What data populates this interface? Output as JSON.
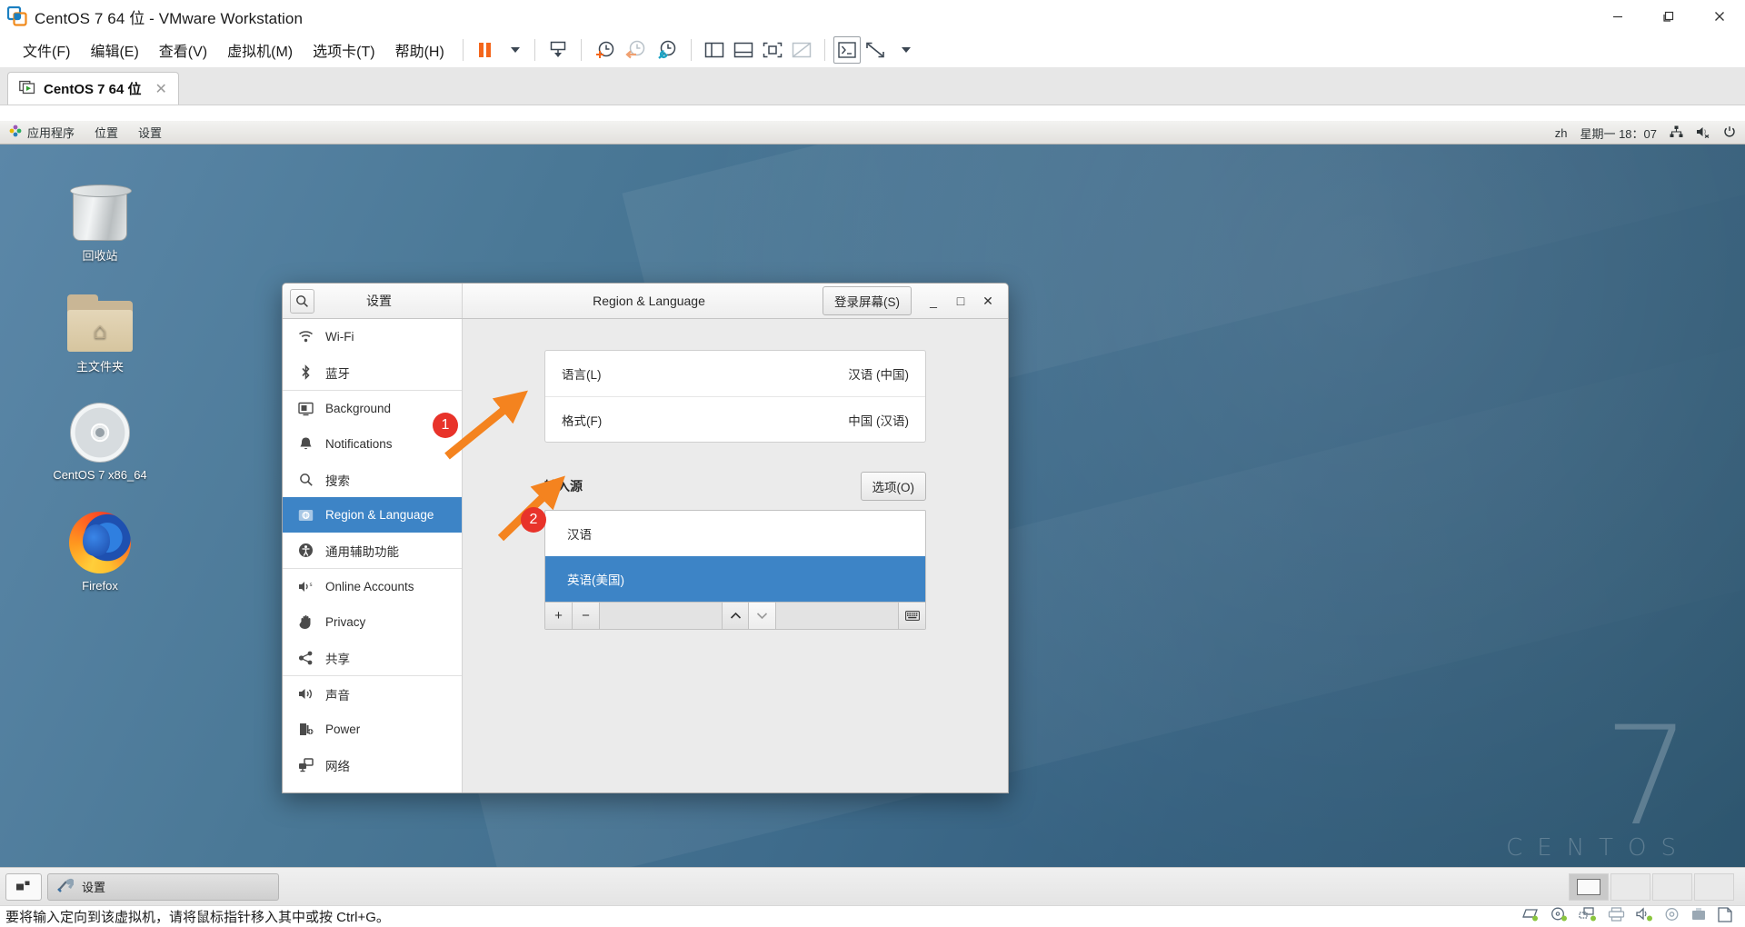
{
  "window": {
    "title": "CentOS 7 64 位 - VMware Workstation",
    "logo_icon": "vmware-logo-icon",
    "controls": {
      "minimize": "–",
      "maximize": "❐",
      "close": "✕"
    }
  },
  "menubar": {
    "items": [
      {
        "label": "文件(F)",
        "name": "menu-file"
      },
      {
        "label": "编辑(E)",
        "name": "menu-edit"
      },
      {
        "label": "查看(V)",
        "name": "menu-view"
      },
      {
        "label": "虚拟机(M)",
        "name": "menu-vm"
      },
      {
        "label": "选项卡(T)",
        "name": "menu-tabs"
      },
      {
        "label": "帮助(H)",
        "name": "menu-help"
      }
    ],
    "toolbar": [
      {
        "name": "suspend-button",
        "icon": "pause-icon"
      },
      {
        "name": "suspend-dropdown",
        "icon": "chevron-down-icon"
      },
      {
        "name": "power-options-button",
        "icon": "power-down-icon"
      },
      {
        "name": "take-snapshot-button",
        "icon": "snapshot-add-icon"
      },
      {
        "name": "revert-snapshot-button",
        "icon": "snapshot-revert-icon"
      },
      {
        "name": "manage-snapshots-button",
        "icon": "snapshot-manage-icon"
      },
      {
        "name": "show-library-button",
        "icon": "panel-left-icon"
      },
      {
        "name": "show-thumbnails-button",
        "icon": "panel-bottom-icon"
      },
      {
        "name": "show-console-button",
        "icon": "console-view-icon"
      },
      {
        "name": "unity-mode-button",
        "icon": "unity-icon"
      },
      {
        "name": "fullscreen-button",
        "icon": "fullscreen-icon"
      },
      {
        "name": "fullscreen-dropdown",
        "icon": "chevron-down-icon"
      }
    ]
  },
  "tabs": [
    {
      "label": "CentOS 7 64 位",
      "icon": "vm-running-icon",
      "close": "✕",
      "active": true
    }
  ],
  "gnome": {
    "topbar": {
      "left": [
        {
          "label": "应用程序",
          "name": "gnome-applications-menu",
          "icon": "centos-apps-icon"
        },
        {
          "label": "位置",
          "name": "gnome-places-menu"
        },
        {
          "label": "设置",
          "name": "gnome-settings-menu"
        }
      ],
      "right": {
        "input_source": "zh",
        "clock": "星期一 18：07",
        "network_icon": "network-wired-icon",
        "volume_icon": "volume-muted-icon",
        "power_icon": "power-icon"
      }
    },
    "desktop_icons": [
      {
        "label": "回收站",
        "icon": "trash-icon",
        "name": "desktop-icon-trash"
      },
      {
        "label": "主文件夹",
        "icon": "home-folder-icon",
        "name": "desktop-icon-home"
      },
      {
        "label": "CentOS 7 x86_64",
        "icon": "cd-disc-icon",
        "name": "desktop-icon-cd"
      },
      {
        "label": "Firefox",
        "icon": "firefox-icon",
        "name": "desktop-icon-firefox"
      }
    ],
    "wallpaper_watermark": {
      "number": "7",
      "word": "CENTOS"
    }
  },
  "settings": {
    "header": {
      "search_icon": "search-icon",
      "app_title": "设置",
      "panel_title": "Region & Language",
      "login_screen_button": "登录屏幕(S)",
      "minimize": "_",
      "maximize": "□",
      "close": "✕"
    },
    "sidebar": {
      "groups": [
        [
          {
            "label": "Wi-Fi",
            "icon": "wifi-icon",
            "name": "sidebar-item-wifi"
          },
          {
            "label": "蓝牙",
            "icon": "bluetooth-icon",
            "name": "sidebar-item-bluetooth"
          }
        ],
        [
          {
            "label": "Background",
            "icon": "background-icon",
            "name": "sidebar-item-background"
          },
          {
            "label": "Notifications",
            "icon": "bell-icon",
            "name": "sidebar-item-notifications"
          },
          {
            "label": "搜索",
            "icon": "search-icon",
            "name": "sidebar-item-search"
          },
          {
            "label": "Region & Language",
            "icon": "region-language-icon",
            "name": "sidebar-item-region-language",
            "selected": true
          },
          {
            "label": "通用辅助功能",
            "icon": "accessibility-icon",
            "name": "sidebar-item-accessibility"
          }
        ],
        [
          {
            "label": "Online Accounts",
            "icon": "online-accounts-icon",
            "name": "sidebar-item-online-accounts"
          },
          {
            "label": "Privacy",
            "icon": "privacy-hand-icon",
            "name": "sidebar-item-privacy"
          },
          {
            "label": "共享",
            "icon": "sharing-icon",
            "name": "sidebar-item-sharing"
          }
        ],
        [
          {
            "label": "声音",
            "icon": "sound-icon",
            "name": "sidebar-item-sound"
          },
          {
            "label": "Power",
            "icon": "power-plug-icon",
            "name": "sidebar-item-power"
          },
          {
            "label": "网络",
            "icon": "network-icon",
            "name": "sidebar-item-network"
          }
        ]
      ]
    },
    "content": {
      "language_card": [
        {
          "label": "语言(L)",
          "value": "汉语 (中国)",
          "name": "row-language"
        },
        {
          "label": "格式(F)",
          "value": "中国 (汉语)",
          "name": "row-formats"
        }
      ],
      "input_sources": {
        "title": "输入源",
        "options_button": "选项(O)",
        "items": [
          {
            "label": "汉语",
            "selected": false
          },
          {
            "label": "英语(美国)",
            "selected": true
          }
        ],
        "toolbar": {
          "add": "+",
          "remove": "−",
          "move_up": "⌃",
          "move_down": "⌄",
          "keyboard_icon": "keyboard-icon"
        }
      }
    }
  },
  "annotations": [
    {
      "number": "1",
      "target": "Region & Language sidebar item"
    },
    {
      "number": "2",
      "target": "Add input source button"
    }
  ],
  "taskbar": {
    "show_desktop_icon": "show-desktop-icon",
    "task_label": "设置",
    "task_icon": "settings-tools-icon",
    "workspaces": 4,
    "active_workspace": 1
  },
  "statusbar": {
    "message": "要将输入定向到该虚拟机，请将鼠标指针移入其中或按 Ctrl+G。",
    "devices": [
      {
        "name": "hard-disk-icon"
      },
      {
        "name": "cd-dvd-icon"
      },
      {
        "name": "network-adapter-icon"
      },
      {
        "name": "printer-icon"
      },
      {
        "name": "sound-card-icon"
      },
      {
        "name": "optical-icon"
      },
      {
        "name": "usb-icon"
      },
      {
        "name": "message-log-icon"
      }
    ]
  },
  "colors": {
    "accent_blue": "#3d84c6",
    "annotation_red": "#e8332a",
    "annotation_orange": "#f4831f",
    "vmware_orange": "#f4661b",
    "desktop_blue": "#3c6383"
  }
}
